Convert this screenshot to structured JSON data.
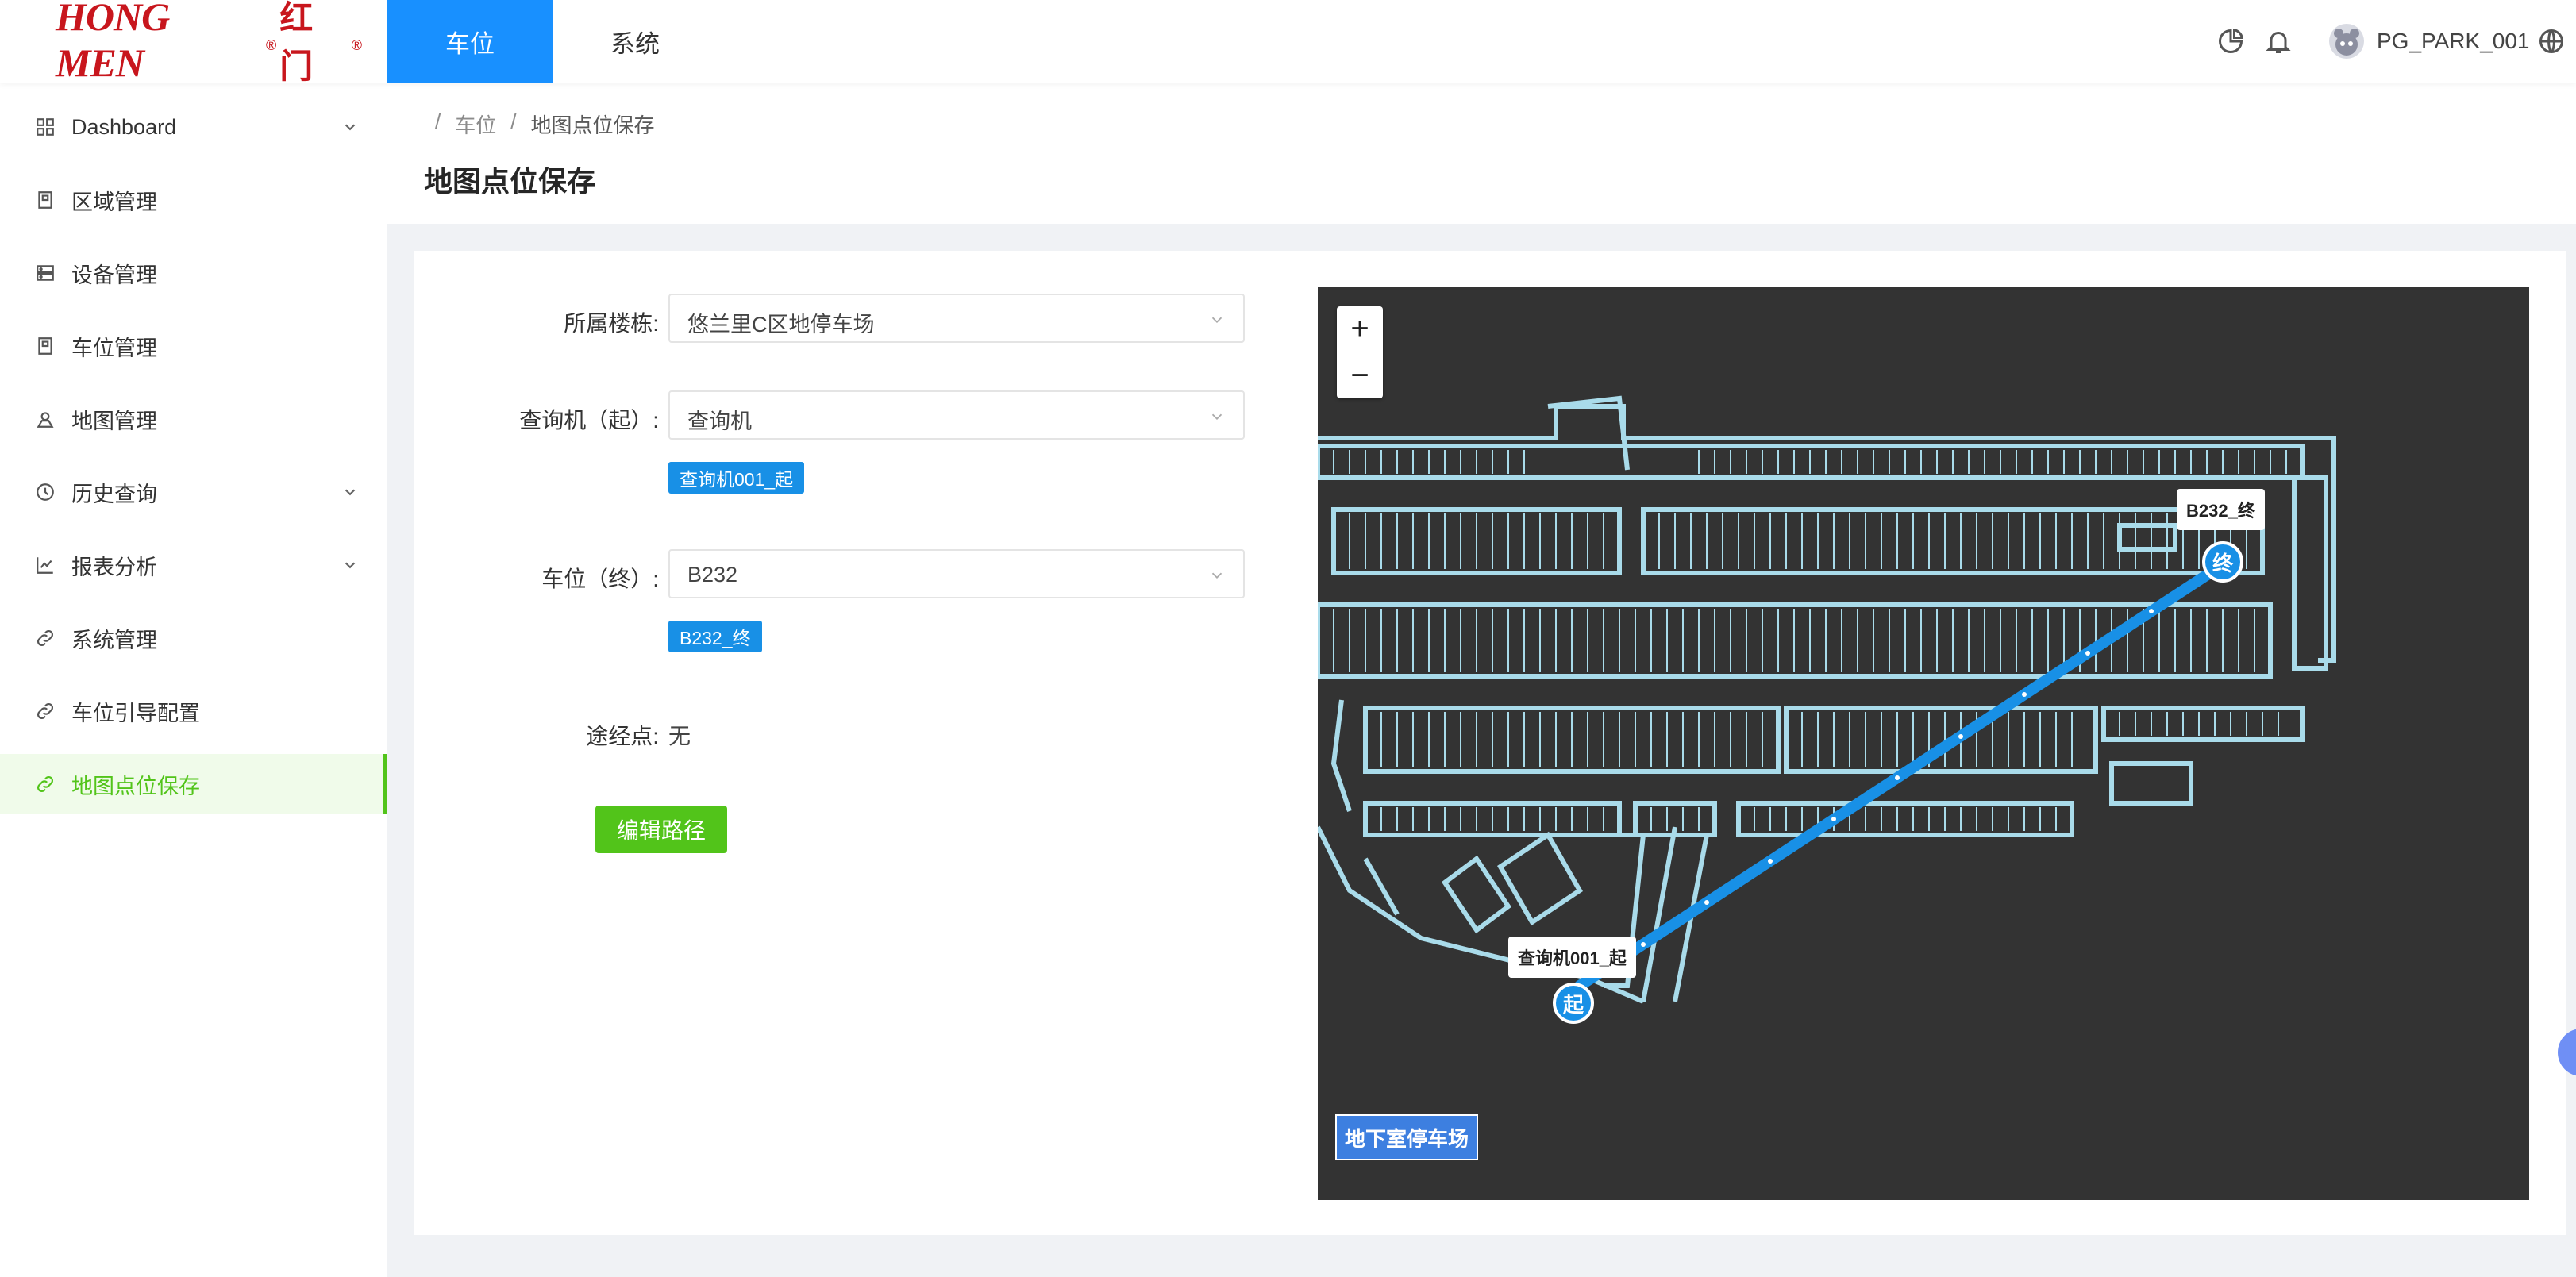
{
  "header": {
    "logo_en": "HONG MEN",
    "logo_reg": "®",
    "logo_cn": "红门",
    "tabs": [
      {
        "label": "车位",
        "active": true
      },
      {
        "label": "系统",
        "active": false
      }
    ],
    "user": "PG_PARK_001",
    "icons": [
      "pie-chart-icon",
      "bell-icon",
      "globe-icon"
    ]
  },
  "sidebar": {
    "items": [
      {
        "label": "Dashboard",
        "icon": "dashboard-icon",
        "expandable": true
      },
      {
        "label": "区域管理",
        "icon": "area-icon",
        "expandable": false
      },
      {
        "label": "设备管理",
        "icon": "server-icon",
        "expandable": false
      },
      {
        "label": "车位管理",
        "icon": "parking-icon",
        "expandable": false
      },
      {
        "label": "地图管理",
        "icon": "map-pin-icon",
        "expandable": false
      },
      {
        "label": "历史查询",
        "icon": "clock-icon",
        "expandable": true
      },
      {
        "label": "报表分析",
        "icon": "line-chart-icon",
        "expandable": true
      },
      {
        "label": "系统管理",
        "icon": "link-icon",
        "expandable": false
      },
      {
        "label": "车位引导配置",
        "icon": "link-icon",
        "expandable": false
      },
      {
        "label": "地图点位保存",
        "icon": "link-icon",
        "expandable": false,
        "active": true
      }
    ]
  },
  "breadcrumb": {
    "sep": "/",
    "items": [
      "车位",
      "地图点位保存"
    ]
  },
  "page_title": "地图点位保存",
  "form": {
    "building_label": "所属楼栋:",
    "building_value": "悠兰里C区地停车场",
    "kiosk_label": "查询机（起）:",
    "kiosk_value": "查询机",
    "kiosk_tag": "查询机001_起",
    "space_label": "车位（终）:",
    "space_value": "B232",
    "space_tag": "B232_终",
    "via_label": "途经点:",
    "via_value": "无",
    "edit_button": "编辑路径"
  },
  "map": {
    "zoom_in": "+",
    "zoom_out": "−",
    "floor_button": "地下室停车场",
    "start_label": "查询机001_起",
    "start_pin": "起",
    "end_label": "B232_终",
    "end_pin": "终",
    "colors": {
      "background": "#333333",
      "structure": "#a9dbea",
      "route": "#1890e6"
    }
  },
  "colors": {
    "primary": "#1890ff",
    "success": "#52c41a",
    "brand": "#c8161d"
  }
}
